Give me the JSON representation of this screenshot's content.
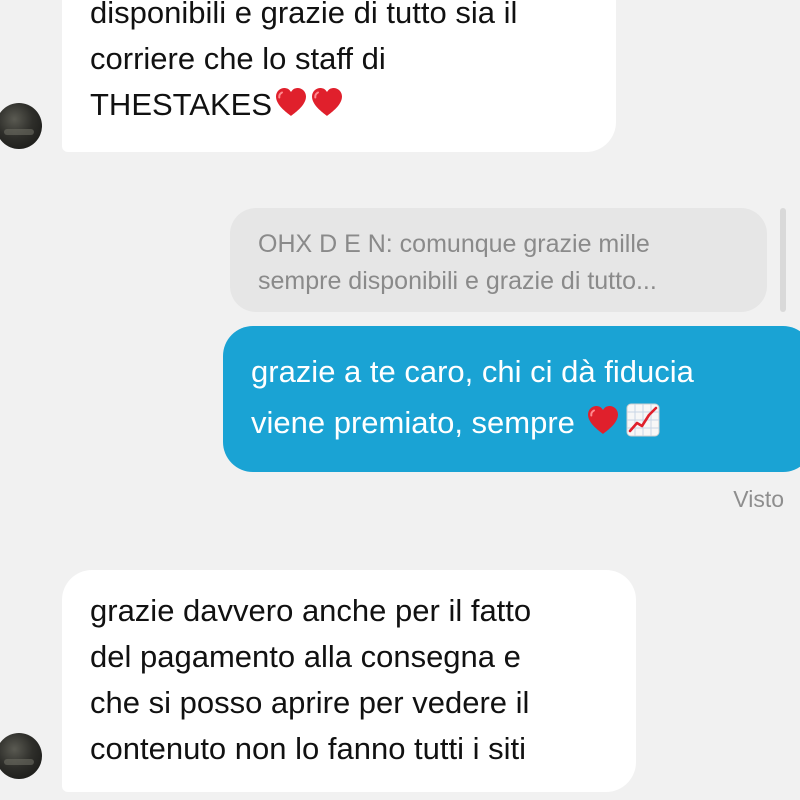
{
  "messages": {
    "incoming_1": {
      "line1": "disponibili e grazie di tutto sia il",
      "line2": "corriere che lo staff di",
      "line3": "THESTAKES"
    },
    "reply_quote": {
      "line1": "OHX D E N: comunque grazie mille",
      "line2": "sempre disponibili e grazie di tutto..."
    },
    "outgoing_1": {
      "line1": "grazie a te caro, chi ci dà fiducia",
      "line2": "viene premiato, sempre"
    },
    "status": "Visto",
    "incoming_2": {
      "line1": "grazie davvero anche per il fatto",
      "line2": "del pagamento alla consegna e",
      "line3": "che si posso aprire per vedere il",
      "line4": "contenuto non lo fanno tutti i siti"
    }
  },
  "icons": {
    "heart": "red-heart-emoji",
    "chart": "chart-increasing-emoji",
    "avatar": "contact-avatar"
  },
  "colors": {
    "background": "#f1f1f1",
    "incoming_bubble": "#ffffff",
    "outgoing_bubble": "#1aa3d4",
    "quote_bubble": "#e6e6e6",
    "heart": "#e0202c"
  }
}
